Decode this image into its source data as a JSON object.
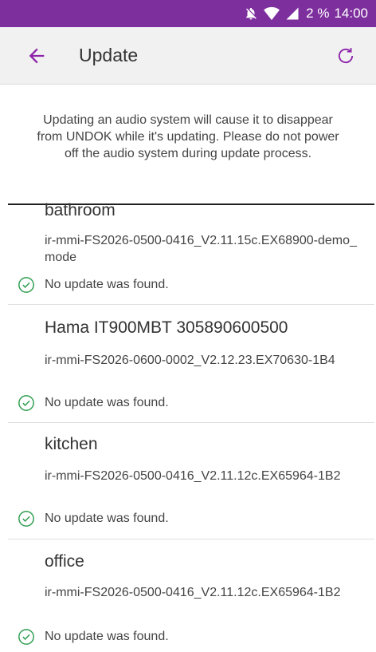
{
  "status_bar": {
    "battery_text": "2 %",
    "time": "14:00",
    "icons": [
      "notifications-off-icon",
      "wifi-icon",
      "cell-signal-icon"
    ]
  },
  "app_bar": {
    "title": "Update",
    "back_icon": "arrow-left-icon",
    "refresh_icon": "refresh-icon",
    "accent_color": "#8e24aa"
  },
  "notice": "Updating an audio system will cause it to disappear from UNDOK while it's updating. Please do not power off the audio system during update process.",
  "devices": [
    {
      "name": "bathroom",
      "firmware": "ir-mmi-FS2026-0500-0416_V2.11.15c.EX68900-demo_mode",
      "status": "No update was found."
    },
    {
      "name": "Hama IT900MBT 305890600500",
      "firmware": "ir-mmi-FS2026-0600-0002_V2.12.23.EX70630-1B4",
      "status": "No update was found."
    },
    {
      "name": "kitchen",
      "firmware": "ir-mmi-FS2026-0500-0416_V2.11.12c.EX65964-1B2",
      "status": "No update was found."
    },
    {
      "name": "office",
      "firmware": "ir-mmi-FS2026-0500-0416_V2.11.12c.EX65964-1B2",
      "status": "No update was found."
    }
  ],
  "colors": {
    "status_bar": "#7e2f9e",
    "app_bar": "#f1f1f1",
    "check": "#2e9e4f"
  }
}
